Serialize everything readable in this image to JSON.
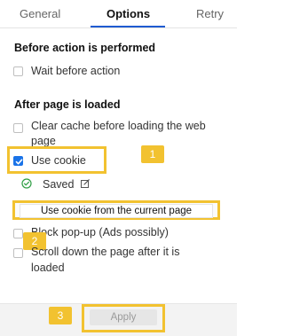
{
  "tabs": [
    {
      "label": "General",
      "active": false
    },
    {
      "label": "Options",
      "active": true
    },
    {
      "label": "Retry",
      "active": false
    }
  ],
  "sections": {
    "before_title": "Before action is performed",
    "after_title": "After page is loaded"
  },
  "options": {
    "wait_before_action": {
      "label": "Wait before action",
      "checked": false
    },
    "clear_cache_line1": "Clear cache before loading the web",
    "clear_cache_line2": "page",
    "clear_cache_checked": false,
    "use_cookie": {
      "label": "Use cookie",
      "checked": true
    },
    "saved_label": "Saved",
    "cookie_suggestion": "Use cookie from the current page",
    "block_popup": {
      "label": "Block pop-up (Ads possibly)",
      "checked": false
    },
    "scroll_down_line1": "Scroll down the page after it is",
    "scroll_down_line2": "loaded",
    "scroll_down_checked": false
  },
  "callouts": {
    "badge1": "1",
    "badge2": "2",
    "badge3": "3"
  },
  "footer": {
    "apply_label": "Apply"
  },
  "colors": {
    "accent": "#1a73e8",
    "callout": "#f2c230",
    "success": "#2e9e44"
  },
  "icons": {
    "saved": "check-circle-icon",
    "edit": "edit-icon"
  }
}
